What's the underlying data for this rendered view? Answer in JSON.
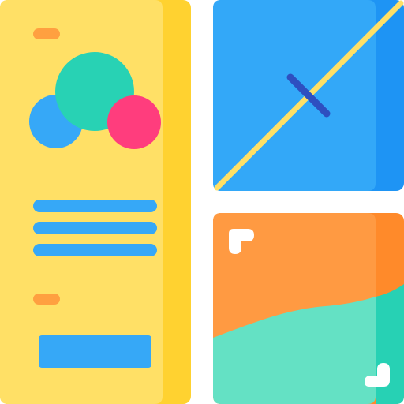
{
  "colors": {
    "background": "#FFFFFF",
    "flyer_face": "#FFE066",
    "flyer_edge": "#FFD230",
    "pill": "#FFA040",
    "circle_blue": "#36A8F7",
    "circle_teal": "#28D2B4",
    "circle_pink": "#FF3D7D",
    "text_line": "#36A8F7",
    "flyer_button": "#36A8F7",
    "swatch_blue_face": "#33A8F8",
    "swatch_blue_edge": "#1E94F4",
    "swatch_blue_diagonal": "#FFE066",
    "swatch_blue_mark": "#2E4FC0",
    "swatch_orange_face": "#FF9A42",
    "swatch_orange_edge": "#FF8A2A",
    "swatch_wave_face": "#64E1C4",
    "swatch_wave_edge": "#27D1B4",
    "corner_marker": "#FFFFFF"
  },
  "icons": {
    "flyer": "flyer-icon",
    "blue_swatch": "blue-swatch-icon",
    "orange_swatch": "orange-swatch-icon"
  },
  "flyer": {
    "text_line_count": 3
  }
}
